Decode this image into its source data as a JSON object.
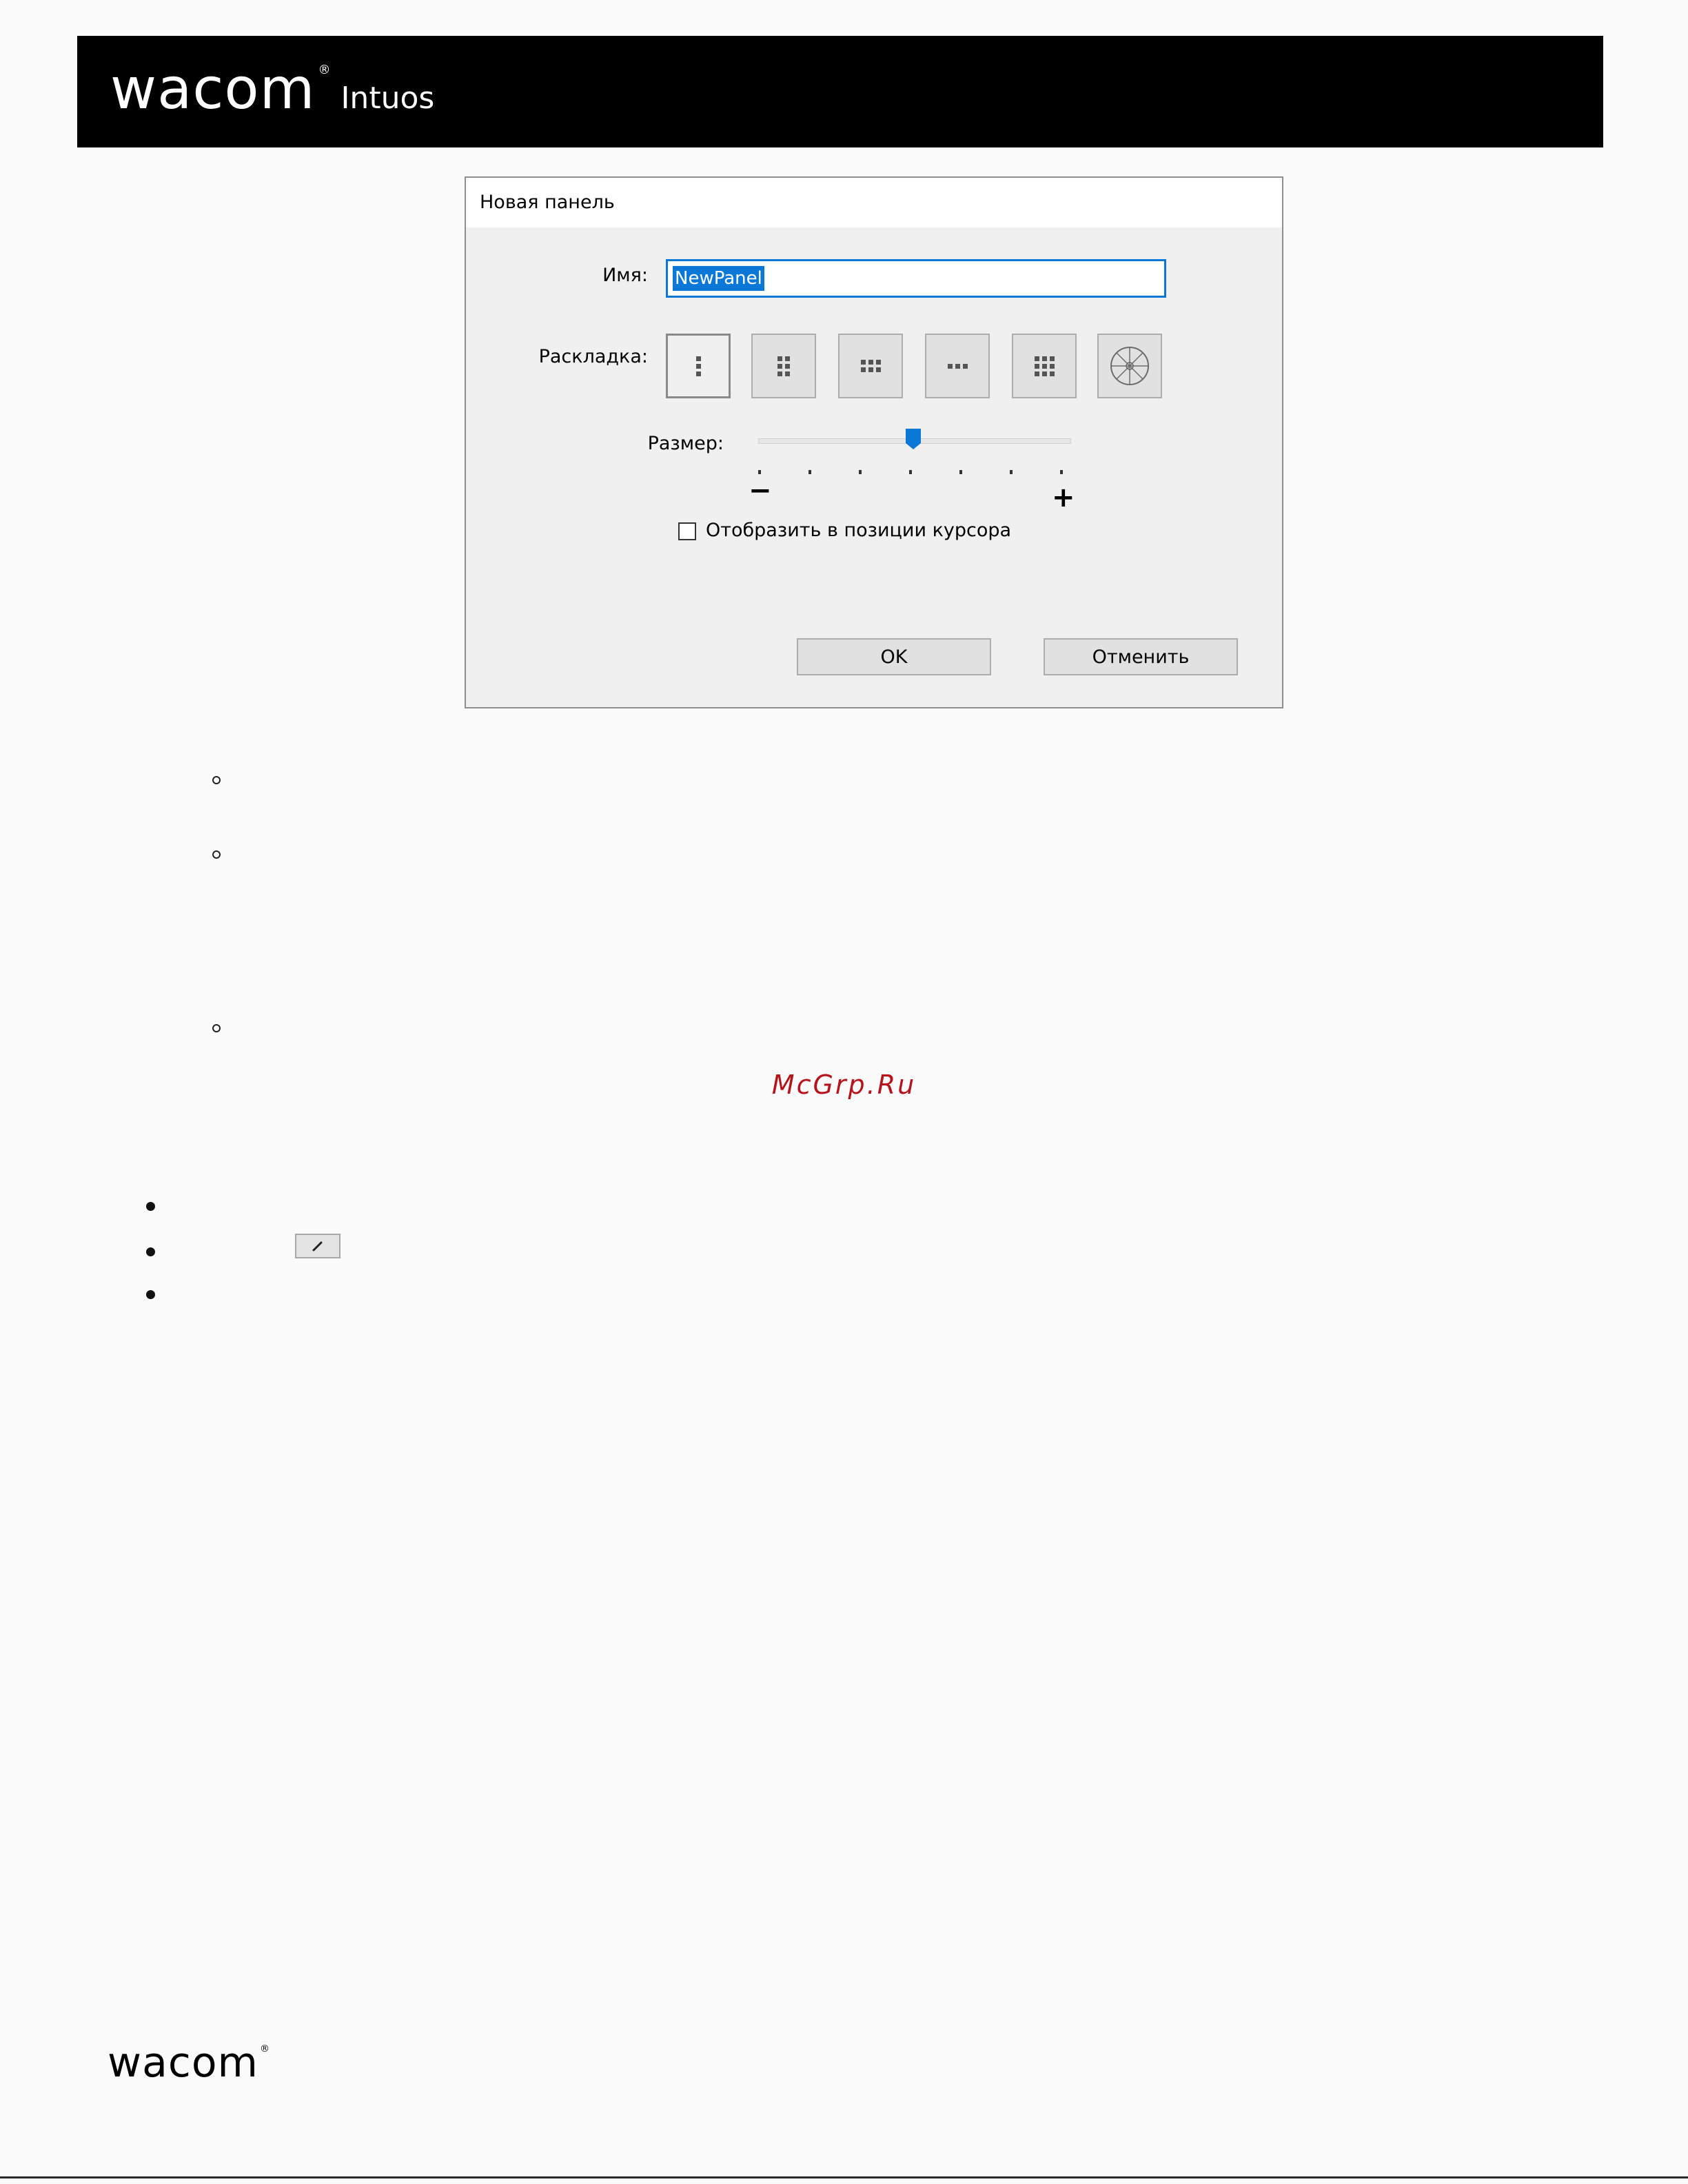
{
  "header": {
    "brand": "wacom",
    "registered_mark": "®",
    "product": "Intuos",
    "background_color": "#000000"
  },
  "dialog": {
    "title": "Новая панель",
    "name_label": "Имя:",
    "name_value": "NewPanel",
    "layout_label": "Раскладка:",
    "layout_options": [
      {
        "icon": "layout-1col-icon",
        "selected": true
      },
      {
        "icon": "layout-2col-icon",
        "selected": false
      },
      {
        "icon": "layout-3col-icon",
        "selected": false
      },
      {
        "icon": "layout-row-icon",
        "selected": false
      },
      {
        "icon": "layout-grid-icon",
        "selected": false
      },
      {
        "icon": "radial-menu-icon",
        "selected": false
      }
    ],
    "size_label": "Размер:",
    "size_level": 0.5,
    "size_minus": "−",
    "size_plus": "+",
    "cursor_position_checkbox_label": "Отобразить в позиции курсора",
    "cursor_position_checked": false,
    "ok_label": "OK",
    "cancel_label": "Отменить",
    "accent_color": "#0B78D7"
  },
  "watermark": "McGrp.Ru",
  "watermark_color": "#B5141C",
  "footer": {
    "brand": "wacom",
    "registered_mark": "®"
  }
}
